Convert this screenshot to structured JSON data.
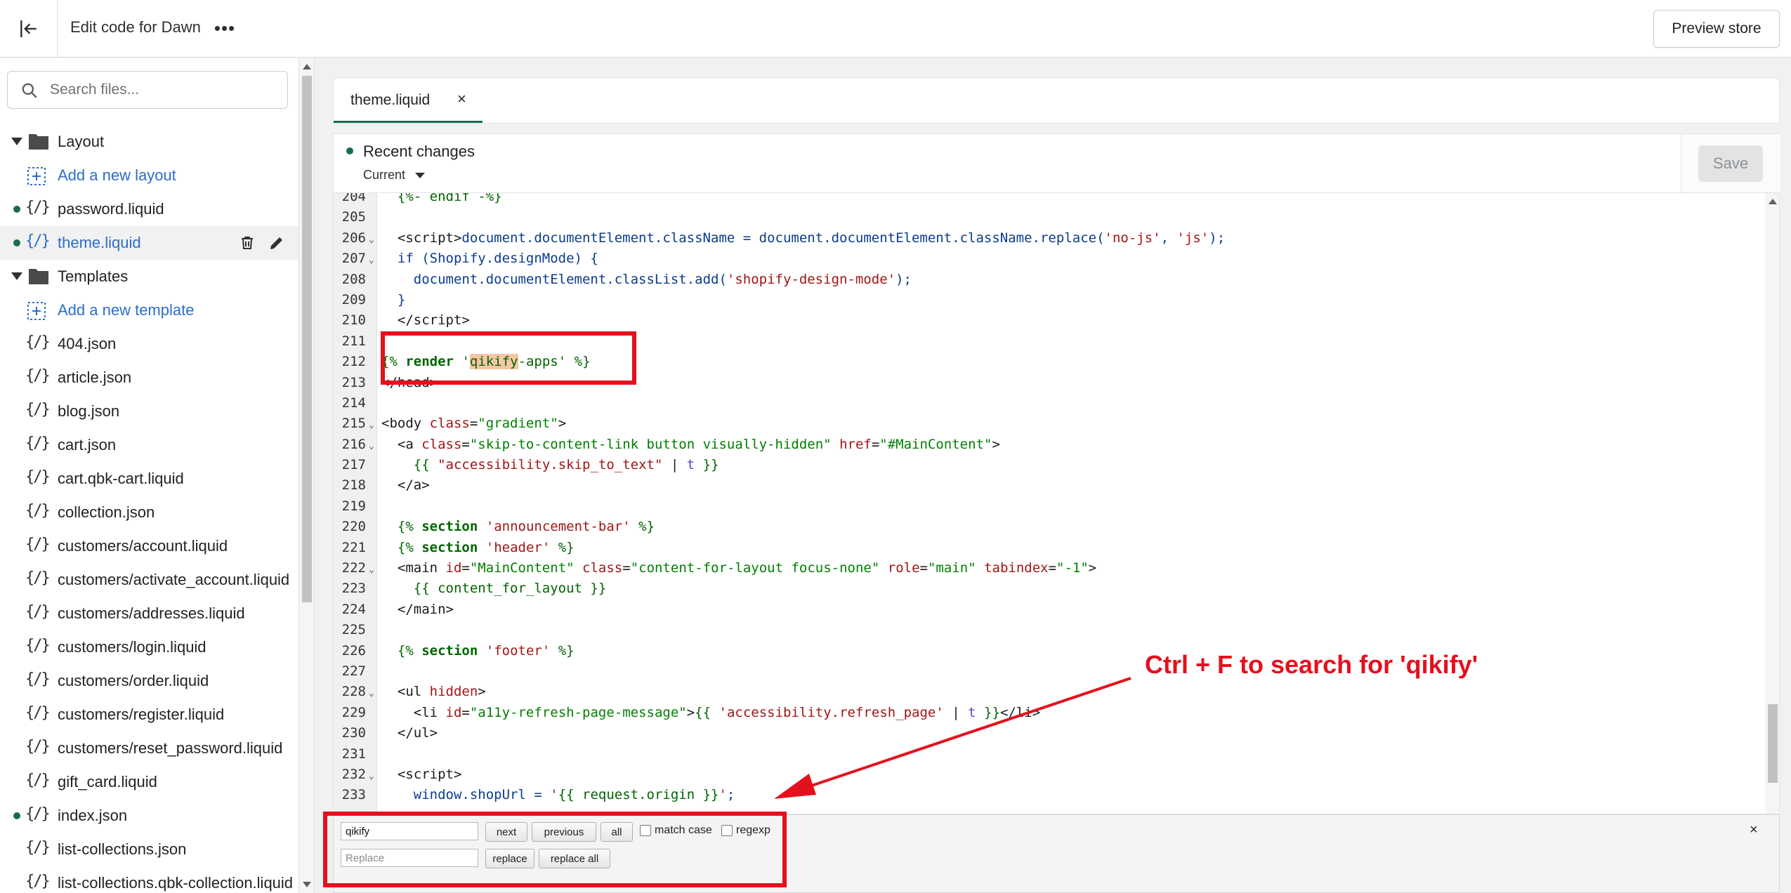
{
  "topbar": {
    "title": "Edit code for Dawn",
    "more": "•••",
    "preview_label": "Preview store"
  },
  "sidebar": {
    "search_placeholder": "Search files...",
    "items": [
      {
        "kind": "folder",
        "label": "Layout"
      },
      {
        "kind": "add",
        "label": "Add a new layout"
      },
      {
        "kind": "file",
        "label": "password.liquid",
        "dot": true
      },
      {
        "kind": "file",
        "label": "theme.liquid",
        "dot": true,
        "selected": true
      },
      {
        "kind": "folder",
        "label": "Templates"
      },
      {
        "kind": "add",
        "label": "Add a new template"
      },
      {
        "kind": "file",
        "label": "404.json"
      },
      {
        "kind": "file",
        "label": "article.json"
      },
      {
        "kind": "file",
        "label": "blog.json"
      },
      {
        "kind": "file",
        "label": "cart.json"
      },
      {
        "kind": "file",
        "label": "cart.qbk-cart.liquid"
      },
      {
        "kind": "file",
        "label": "collection.json"
      },
      {
        "kind": "file",
        "label": "customers/account.liquid"
      },
      {
        "kind": "file",
        "label": "customers/activate_account.liquid"
      },
      {
        "kind": "file",
        "label": "customers/addresses.liquid"
      },
      {
        "kind": "file",
        "label": "customers/login.liquid"
      },
      {
        "kind": "file",
        "label": "customers/order.liquid"
      },
      {
        "kind": "file",
        "label": "customers/register.liquid"
      },
      {
        "kind": "file",
        "label": "customers/reset_password.liquid"
      },
      {
        "kind": "file",
        "label": "gift_card.liquid"
      },
      {
        "kind": "file",
        "label": "index.json",
        "dot": true
      },
      {
        "kind": "file",
        "label": "list-collections.json"
      },
      {
        "kind": "file",
        "label": "list-collections.qbk-collection.liquid"
      }
    ]
  },
  "tab": {
    "label": "theme.liquid",
    "close": "×"
  },
  "recent": {
    "title": "Recent changes",
    "current": "Current",
    "save_label": "Save"
  },
  "code": {
    "lines": [
      {
        "n": "204",
        "fold": false,
        "html": "  <span class=\"liq\">{%- endif -%}</span>"
      },
      {
        "n": "205",
        "fold": false,
        "html": ""
      },
      {
        "n": "206",
        "fold": true,
        "html": "  &lt;script&gt;<span class=\"js\">document.documentElement.className = document.documentElement.className.replace(</span><span class=\"str\">'no-js'</span><span class=\"js\">, </span><span class=\"str\">'js'</span><span class=\"js\">);</span>"
      },
      {
        "n": "207",
        "fold": true,
        "html": "  <span class=\"js\">if (Shopify.designMode) {</span>"
      },
      {
        "n": "208",
        "fold": false,
        "html": "    <span class=\"js\">document.documentElement.classList.add(</span><span class=\"str\">'shopify-design-mode'</span><span class=\"js\">);</span>"
      },
      {
        "n": "209",
        "fold": false,
        "html": "  <span class=\"js\">}</span>"
      },
      {
        "n": "210",
        "fold": false,
        "html": "  &lt;/script&gt;"
      },
      {
        "n": "211",
        "fold": false,
        "html": ""
      },
      {
        "n": "212",
        "fold": false,
        "html": "<span class=\"liq\">{%</span> <span class=\"liqkw\">render</span> <span class=\"liq\">'</span><span class=\"liq hl\">qikify</span><span class=\"liq\">-apps'</span> <span class=\"liq\">%}</span>"
      },
      {
        "n": "213",
        "fold": false,
        "html": "&lt;/head&gt;"
      },
      {
        "n": "214",
        "fold": false,
        "html": ""
      },
      {
        "n": "215",
        "fold": true,
        "html": "&lt;body <span class=\"attr\">class</span>=<span class=\"aval\">\"gradient\"</span>&gt;"
      },
      {
        "n": "216",
        "fold": true,
        "html": "  &lt;a <span class=\"attr\">class</span>=<span class=\"aval\">\"skip-to-content-link button visually-hidden\"</span> <span class=\"attr\">href</span>=<span class=\"aval\">\"#MainContent\"</span>&gt;"
      },
      {
        "n": "217",
        "fold": false,
        "html": "    <span class=\"liq\">{{</span> <span class=\"str\">\"accessibility.skip_to_text\"</span> | <span class=\"filt\">t</span> <span class=\"liq\">}}</span>"
      },
      {
        "n": "218",
        "fold": false,
        "html": "  &lt;/a&gt;"
      },
      {
        "n": "219",
        "fold": false,
        "html": ""
      },
      {
        "n": "220",
        "fold": false,
        "html": "  <span class=\"liq\">{%</span> <span class=\"liqkw\">section</span> <span class=\"str\">'announcement-bar'</span> <span class=\"liq\">%}</span>"
      },
      {
        "n": "221",
        "fold": false,
        "html": "  <span class=\"liq\">{%</span> <span class=\"liqkw\">section</span> <span class=\"str\">'header'</span> <span class=\"liq\">%}</span>"
      },
      {
        "n": "222",
        "fold": true,
        "html": "  &lt;main <span class=\"attr\">id</span>=<span class=\"aval\">\"MainContent\"</span> <span class=\"attr\">class</span>=<span class=\"aval\">\"content-for-layout focus-none\"</span> <span class=\"attr\">role</span>=<span class=\"aval\">\"main\"</span> <span class=\"attr\">tabindex</span>=<span class=\"aval\">\"-1\"</span>&gt;"
      },
      {
        "n": "223",
        "fold": false,
        "html": "    <span class=\"liq\">{{ content_for_layout }}</span>"
      },
      {
        "n": "224",
        "fold": false,
        "html": "  &lt;/main&gt;"
      },
      {
        "n": "225",
        "fold": false,
        "html": ""
      },
      {
        "n": "226",
        "fold": false,
        "html": "  <span class=\"liq\">{%</span> <span class=\"liqkw\">section</span> <span class=\"str\">'footer'</span> <span class=\"liq\">%}</span>"
      },
      {
        "n": "227",
        "fold": false,
        "html": ""
      },
      {
        "n": "228",
        "fold": true,
        "html": "  &lt;ul <span class=\"attr\">hidden</span>&gt;"
      },
      {
        "n": "229",
        "fold": false,
        "html": "    &lt;li <span class=\"attr\">id</span>=<span class=\"aval\">\"a11y-refresh-page-message\"</span>&gt;<span class=\"liq\">{{</span> <span class=\"str\">'accessibility.refresh_page'</span> | <span class=\"filt\">t</span> <span class=\"liq\">}}</span>&lt;/li&gt;"
      },
      {
        "n": "230",
        "fold": false,
        "html": "  &lt;/ul&gt;"
      },
      {
        "n": "231",
        "fold": false,
        "html": ""
      },
      {
        "n": "232",
        "fold": true,
        "html": "  &lt;script&gt;"
      },
      {
        "n": "233",
        "fold": false,
        "html": "    <span class=\"js\">window.shopUrl = </span><span class=\"str\">'</span><span class=\"liq\">{{ request.origin }}</span><span class=\"str\">'</span><span class=\"js\">;</span>"
      }
    ]
  },
  "searchpanel": {
    "find_value": "qikify",
    "replace_placeholder": "Replace",
    "next_label": "next",
    "previous_label": "previous",
    "all_label": "all",
    "match_case_label": "match case",
    "regexp_label": "regexp",
    "replace_label": "replace",
    "replace_all_label": "replace all",
    "close": "×"
  },
  "annotation": {
    "text": "Ctrl + F to search for 'qikify'",
    "color": "#e5101e"
  },
  "colors": {
    "accent_green": "#1a6b4f",
    "link_blue": "#2c6ecb"
  }
}
